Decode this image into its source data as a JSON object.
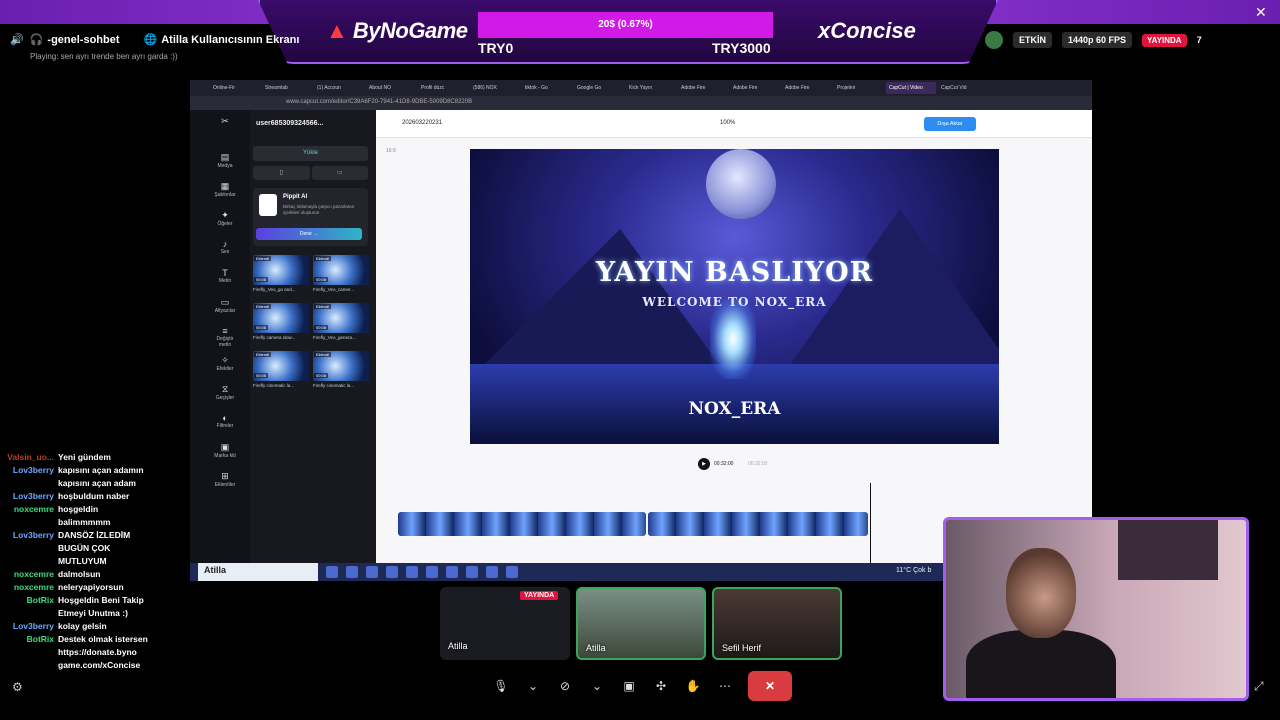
{
  "overlay": {
    "brand_left": "ByNoGame",
    "brand_right": "xConcise",
    "goal_text": "20$ (0.67%)",
    "goal_min": "TRY0",
    "goal_max": "TRY3000",
    "close": "✕"
  },
  "discord": {
    "channel": "-genel-sohbet",
    "screen_title": "Atilla Kullanıcısının Ekranı",
    "activity": "Playing: sen ayrı trende ben ayrı garda :))",
    "status_active": "ETKİN",
    "quality": "1440p 60 FPS",
    "live_label": "YAYINDA",
    "viewer_count": "7"
  },
  "browser": {
    "tabs": [
      "Online-Fir",
      "Streamlab",
      "(1) Accoun",
      "About NO",
      "Profil düzc",
      "(586) NOX",
      "tiktok - Go",
      "Google Go",
      "Kick Yayın",
      "Adobe Fire",
      "Adobe Fire",
      "Adobe Fire",
      "Projeleri",
      "CapCut | Video",
      "CapCut Vid"
    ],
    "url": "www.capcut.com/editor/C39A6F20-7941-41D8-9DBE-5009D8C8220B"
  },
  "capcut": {
    "user": "user685309324566...",
    "nav": [
      "Medya",
      "Şablonlar",
      "Öğeler",
      "Ses",
      "Metin",
      "Altyazılar",
      "Değiştir metin",
      "Efektler",
      "Geçişler",
      "Filtreler",
      "Marka kiti",
      "Eklentiler"
    ],
    "upload": "Yükle",
    "pippit_title": "Pippit AI",
    "pippit_desc": "Birkaç tıklamayla çarpıcı pazarlama içerikleri oluşturun",
    "pippit_btn": "Dene →",
    "thumbs": [
      {
        "tag": "Eklendi",
        "dur": "00:08",
        "cap": "Firefly_Veo_go and..."
      },
      {
        "tag": "Eklendi",
        "dur": "00:08",
        "cap": "Firefly_Veo_camer..."
      },
      {
        "tag": "Eklendi",
        "dur": "00:08",
        "cap": "Firefly camera slow..."
      },
      {
        "tag": "Eklendi",
        "dur": "00:08",
        "cap": "Firefly_Veo_genera..."
      },
      {
        "tag": "Eklendi",
        "dur": "00:08",
        "cap": "Firefly cinematic la..."
      },
      {
        "tag": "Eklendi",
        "dur": "00:08",
        "cap": "Firefly cinematic la..."
      }
    ],
    "project": "202603220231",
    "zoom": "100%",
    "export": "Dışa Aktar",
    "canvas_title": "YAYIN BASLIYOR",
    "canvas_sub": "WELCOME TO NOX_ERA",
    "canvas_brand": "NOX_ERA",
    "timecode": "00:32:00",
    "timecode_total": "00:32:00",
    "ratio": "16:9"
  },
  "taskbar": {
    "user": "Atilla",
    "weather": "11°C  Çok b"
  },
  "chat": [
    {
      "user": "Valsin_uo...",
      "text": "Yeni gündem",
      "color": "#c0392b"
    },
    {
      "user": "Lov3berry",
      "text": "kapısını açan adamın kapısını açan adam",
      "color": "#6aa8ff"
    },
    {
      "user": "Lov3berry",
      "text": "hoşbuldum naber",
      "color": "#6aa8ff"
    },
    {
      "user": "noxcemre",
      "text": "hoşgeldin balimmmmm",
      "color": "#3ddc84"
    },
    {
      "user": "Lov3berry",
      "text": "DANSÖZ İZLEDİM BUGÜN ÇOK MUTLUYUM",
      "color": "#6aa8ff"
    },
    {
      "user": "noxcemre",
      "text": "dalmolsun",
      "color": "#3ddc84"
    },
    {
      "user": "noxcemre",
      "text": "neleryapiyorsun",
      "color": "#3ddc84"
    },
    {
      "user": "BotRix",
      "text": "Hoşgeldin Beni Takip Etmeyi Unutma :)",
      "color": "#3ddc84"
    },
    {
      "user": "Lov3berry",
      "text": "kolay gelsin",
      "color": "#6aa8ff"
    },
    {
      "user": "BotRix",
      "text": "Destek olmak istersen https://donate.byno game.com/xConcise",
      "color": "#3ddc84"
    }
  ],
  "call": {
    "tiles": [
      {
        "label": "Atilla",
        "live": "YAYINDA"
      },
      {
        "label": "Atilla",
        "live": ""
      },
      {
        "label": "Sefil Herif",
        "live": ""
      }
    ]
  }
}
